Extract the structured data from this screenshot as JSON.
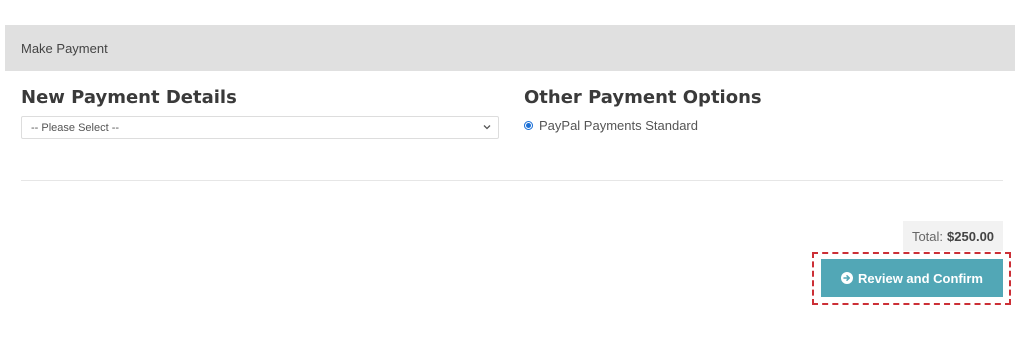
{
  "panel": {
    "header_title": "Make Payment"
  },
  "new_payment": {
    "title": "New Payment Details",
    "select": {
      "selected_value": "-- Please Select --",
      "icon": "chevron-down-icon"
    }
  },
  "other_payment": {
    "title": "Other Payment Options",
    "options": [
      {
        "label": "PayPal Payments Standard",
        "selected": true
      }
    ]
  },
  "summary": {
    "total_label": "Total:",
    "total_amount": "$250.00"
  },
  "actions": {
    "confirm_label": "Review and Confirm",
    "confirm_icon": "circle-arrow-right-icon"
  },
  "colors": {
    "header_bg": "#e0e0e0",
    "button_bg": "#52a7b6",
    "highlight_border": "#cc2f36",
    "radio_accent": "#1a6fd6"
  }
}
